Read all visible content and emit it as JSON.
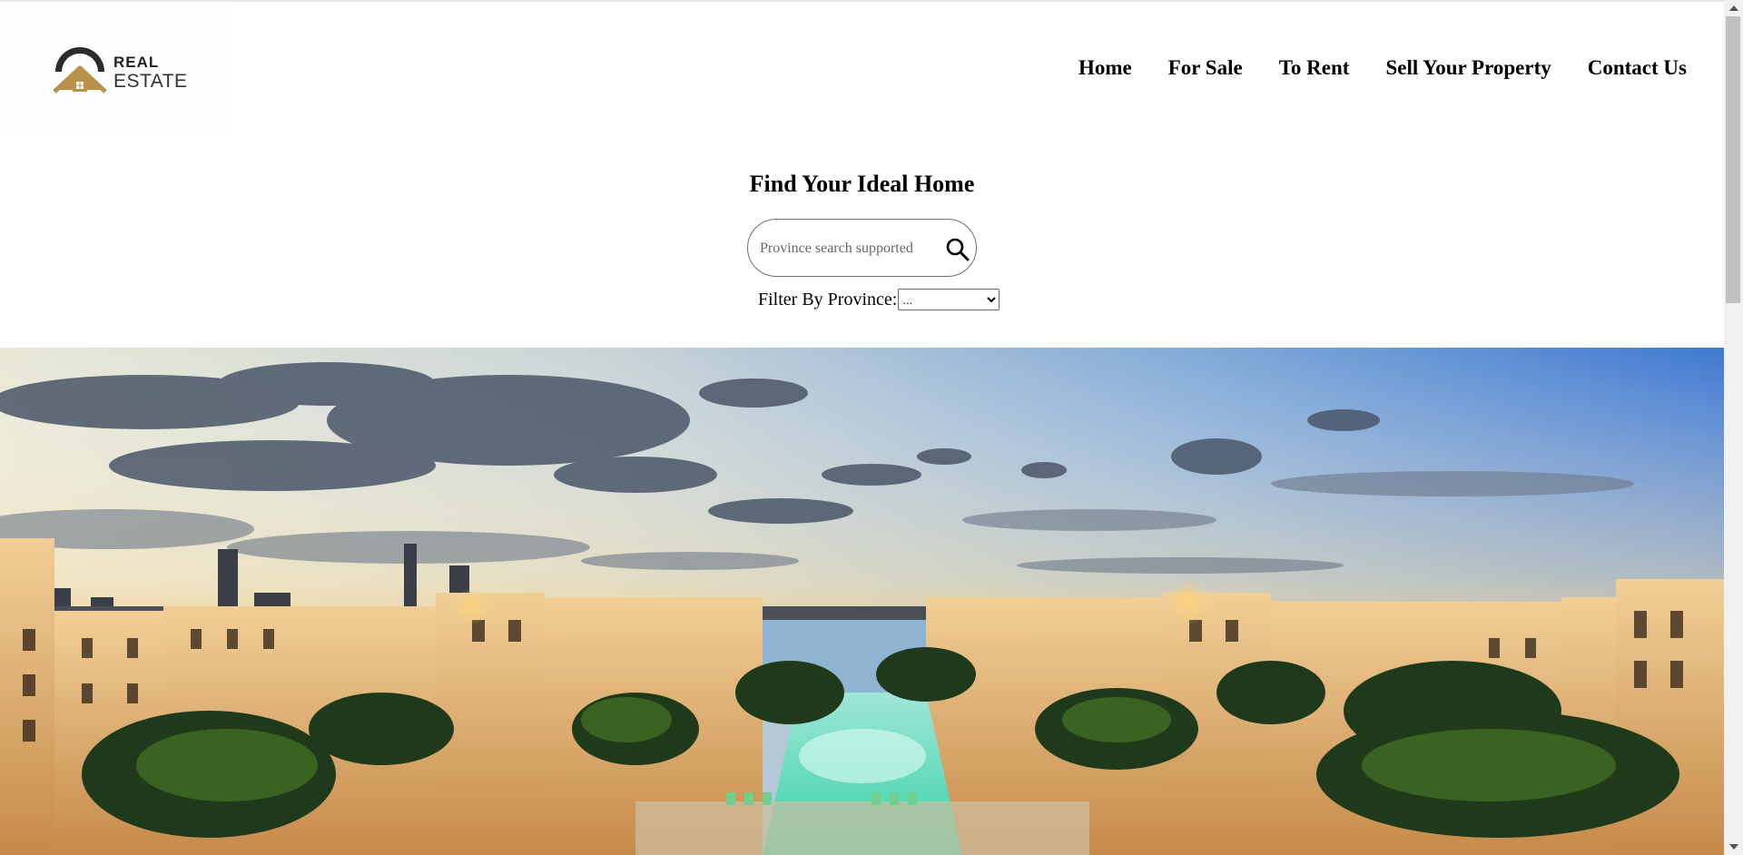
{
  "brand": {
    "line1": "REAL",
    "line2": "ESTATE",
    "colors": {
      "roof": "#2b2b2b",
      "house": "#b8924a"
    }
  },
  "nav": {
    "items": [
      {
        "label": "Home"
      },
      {
        "label": "For Sale"
      },
      {
        "label": "To Rent"
      },
      {
        "label": "Sell Your Property"
      },
      {
        "label": "Contact Us"
      }
    ]
  },
  "search": {
    "title": "Find Your Ideal Home",
    "placeholder": "Province search supported",
    "icon": "search-icon"
  },
  "filter": {
    "label": "Filter By Province:",
    "selected": "..."
  },
  "hero": {
    "description_icon": "hero-image"
  }
}
